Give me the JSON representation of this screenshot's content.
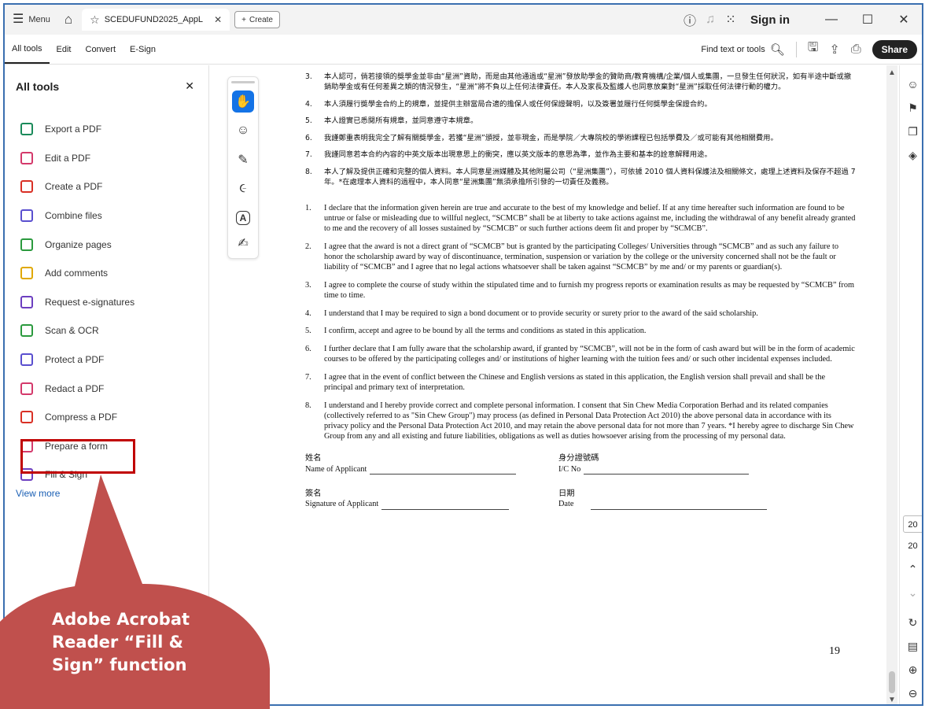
{
  "titlebar": {
    "menu_label": "Menu",
    "tab_title": "SCEDUFUND2025_AppL",
    "create_label": "Create",
    "signin_label": "Sign in"
  },
  "toolbar": {
    "tabs": [
      "All tools",
      "Edit",
      "Convert",
      "E-Sign"
    ],
    "find_label": "Find text or tools",
    "share_label": "Share"
  },
  "left_panel": {
    "title": "All tools",
    "items": [
      {
        "label": "Export a PDF",
        "icon": "export-pdf-icon",
        "color": "#1a8a5a"
      },
      {
        "label": "Edit a PDF",
        "icon": "edit-pdf-icon",
        "color": "#d4396b"
      },
      {
        "label": "Create a PDF",
        "icon": "create-pdf-icon",
        "color": "#d93025"
      },
      {
        "label": "Combine files",
        "icon": "combine-files-icon",
        "color": "#5a4fcf"
      },
      {
        "label": "Organize pages",
        "icon": "organize-pages-icon",
        "color": "#2b9a3e"
      },
      {
        "label": "Add comments",
        "icon": "add-comments-icon",
        "color": "#e0a800"
      },
      {
        "label": "Request e-signatures",
        "icon": "request-esign-icon",
        "color": "#6c3fc0"
      },
      {
        "label": "Scan & OCR",
        "icon": "scan-ocr-icon",
        "color": "#2b9a3e"
      },
      {
        "label": "Protect a PDF",
        "icon": "protect-pdf-icon",
        "color": "#5a4fcf"
      },
      {
        "label": "Redact a PDF",
        "icon": "redact-pdf-icon",
        "color": "#d4396b"
      },
      {
        "label": "Compress a PDF",
        "icon": "compress-pdf-icon",
        "color": "#d93025"
      },
      {
        "label": "Prepare a form",
        "icon": "prepare-form-icon",
        "color": "#d4396b"
      },
      {
        "label": "Fill & Sign",
        "icon": "fill-sign-icon",
        "color": "#6c3fc0"
      }
    ],
    "view_more": "View more"
  },
  "annotation": {
    "callout_text": "Adobe Acrobat Reader “Fill & Sign” function",
    "highlight_color": "#c00000",
    "callout_color": "#c0504d"
  },
  "document": {
    "zh_items": [
      {
        "num": "3.",
        "text": "本人認可，倘若接領的獎學金並非由“星洲”資助，而是由其他通過或“星洲”發放助學金的贊助商/教育機構/企業/個人或集團，一旦發生任何狀況，如有半途中斷或撤銷助學金或有任何差異之類的情況發生，“星洲”將不負以上任何法律責任。本人及家長及監護人也同意放棄對“星洲”採取任何法律行動的權力。"
      },
      {
        "num": "4.",
        "text": "本人須履行獎學金合約上的規章，並提供主辦當局合適的擔保人或任何保證聲明，以及簽署並履行任何獎學金保證合約。"
      },
      {
        "num": "5.",
        "text": "本人證實已悉閱所有規章，並同意遵守本規章。"
      },
      {
        "num": "6.",
        "text": "我謹鄭重表明我完全了解有關獎學金，若獲“星洲”頒授，並非現金，而是學院／大專院校的學術課程已包括學費及／或可能有其他相關費用。"
      },
      {
        "num": "7.",
        "text": "我謹同意若本合約內容的中英文版本出現意思上的衝突，應以英文版本的意思為準，並作為主要和基本的詮意解釋用途。"
      },
      {
        "num": "8.",
        "text": "本人了解及提供正確和完整的個人資料。本人同意星洲媒體及其他附屬公司（“星洲集團”），可依據 2010 個人資料保護法及相關條文，處理上述資料及保存不超過 7 年。*在處理本人資料的過程中，本人同意“星洲集團”無須承擔所引發的一切責任及義務。"
      }
    ],
    "en_items": [
      {
        "num": "1.",
        "text": "I declare that the information given herein are true and accurate to the best of my knowledge and belief. If at any time hereafter such information are found to be untrue or false or misleading due to willful neglect, “SCMCB” shall be at liberty to take actions against me, including the withdrawal of any benefit already granted to me and the recovery of all losses sustained by “SCMCB” or such further actions deem fit and proper by “SCMCB”."
      },
      {
        "num": "2.",
        "text": "I agree that the award is not a direct grant of “SCMCB” but is granted by the participating Colleges/ Universities through “SCMCB” and as such any failure to honor the scholarship award by way of discontinuance, termination, suspension or variation by the college or the university concerned shall not be the fault or liability of “SCMCB” and I agree that no legal actions whatsoever shall be taken against “SCMCB” by me and/ or my parents or guardian(s)."
      },
      {
        "num": "3.",
        "text": "I agree to complete the course of study within the stipulated time and to furnish my progress reports or examination results as may be requested by “SCMCB” from time to time."
      },
      {
        "num": "4.",
        "text": "I understand that I may be required to sign a bond document or to provide security or surety prior to the award of the said scholarship."
      },
      {
        "num": "5.",
        "text": "I confirm, accept and agree to be bound by all the terms and conditions as stated in this application."
      },
      {
        "num": "6.",
        "text": "I further declare that I am fully aware that the scholarship award, if granted by “SCMCB”, will not be in the form of cash award but will be in the form of academic courses to be offered by the participating colleges and/ or institutions of higher learning with the tuition fees and/ or such other incidental expenses included."
      },
      {
        "num": "7.",
        "text": "I agree that in the event of conflict between the Chinese and English versions as stated in this application, the English version shall prevail and shall be the principal and primary text of interpretation."
      },
      {
        "num": "8.",
        "text": "I understand and I hereby provide correct and complete personal information. I consent that Sin Chew Media Corporation Berhad and its related companies (collectively referred to as \"Sin Chew Group\") may process (as defined in Personal Data Protection Act 2010) the above personal data in accordance with its privacy policy and the Personal Data Protection Act 2010, and may retain the above personal data for not more than 7 years. *I hereby agree to discharge Sin Chew Group from any and all existing and future liabilities, obligations as well as duties howsoever arising from the processing of my personal data."
      }
    ],
    "sign_fields": [
      {
        "zh": "姓名",
        "en": "Name of Applicant"
      },
      {
        "zh": "身分證號碼",
        "en": "I/C No"
      },
      {
        "zh": "簽名",
        "en": "Signature of Applicant"
      },
      {
        "zh": "日期",
        "en": "Date"
      }
    ],
    "page_number": "19"
  },
  "right_rail": {
    "page_current": "20",
    "page_total": "20"
  }
}
